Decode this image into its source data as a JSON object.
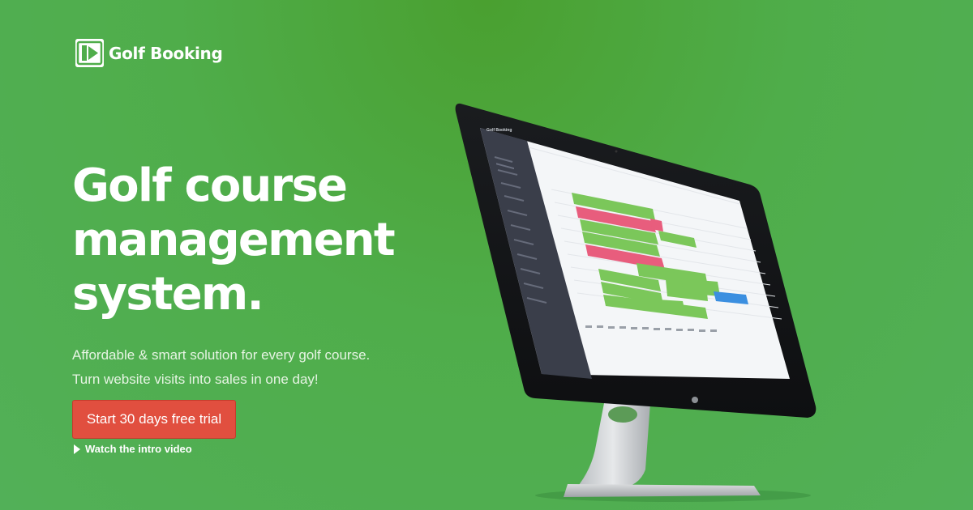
{
  "brand": {
    "name": "Golf Booking",
    "logo_icon": "golf-booking-logo-icon"
  },
  "hero": {
    "headline_lines": [
      "Golf course",
      "management",
      "system."
    ],
    "tagline_lines": [
      "Affordable & smart solution for every golf course.",
      "Turn website visits into sales in one day!"
    ],
    "cta_label": "Start 30 days free trial",
    "video_link_label": "Watch the intro video",
    "video_icon": "play-icon"
  },
  "device": {
    "type": "desktop-monitor",
    "screen_app_brand": "Golf Booking"
  },
  "colors": {
    "background": "#4fad4a",
    "cta": "#e14f3f",
    "text": "#ffffff",
    "app_sidebar": "#3a3e4a",
    "booking_green": "#7bc75a",
    "booking_pink": "#e85d7d",
    "booking_blue": "#3b8fe0"
  }
}
